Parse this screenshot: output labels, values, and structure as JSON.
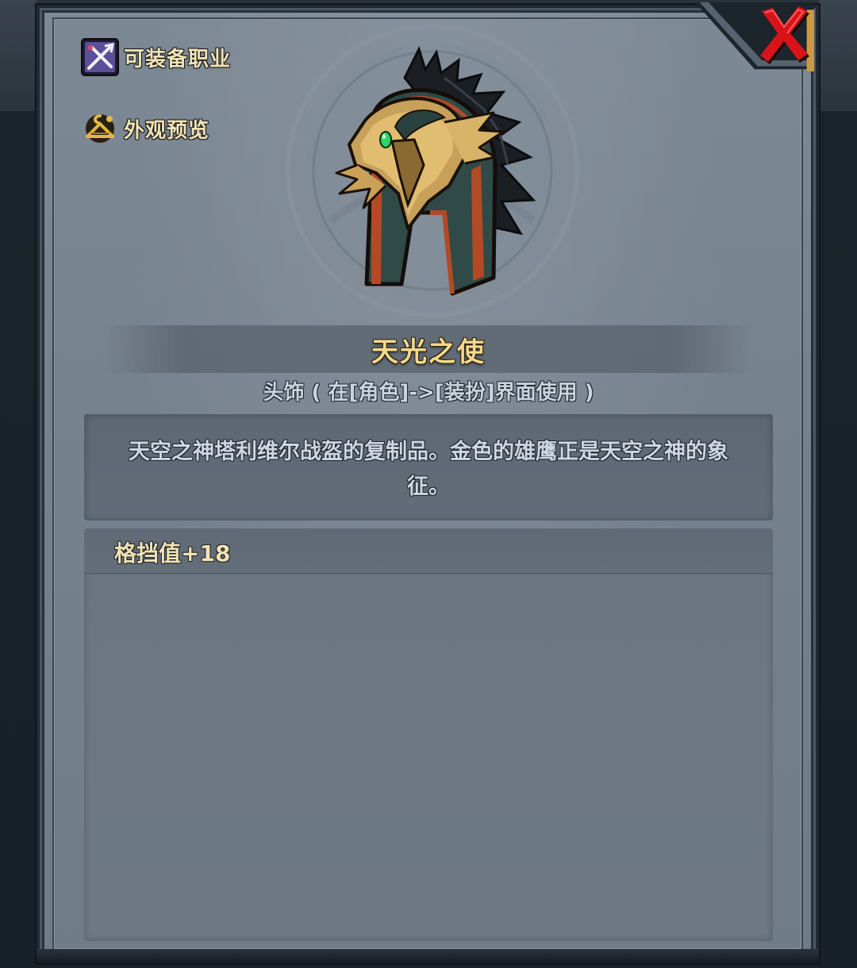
{
  "sidebar": {
    "equip_class_label": "可装备职业",
    "appearance_preview_label": "外观预览"
  },
  "item": {
    "name": "天光之使",
    "type_line": "头饰 ( 在[角色]->[装扮]界面使用 )",
    "description": "天空之神塔利维尔战盔的复制品。金色的雄鹰正是天空之神的象征。",
    "stats": [
      "格挡值+18"
    ]
  },
  "icons": {
    "close": "close-x-icon",
    "equip_class": "crossed-weapons-icon",
    "appearance": "hanger-icon",
    "item": "eagle-helmet-icon"
  },
  "colors": {
    "title_gold": "#f3d98a",
    "label_cream": "#f0e3b6",
    "close_red": "#d8141a",
    "panel_gray": "#7a8692"
  }
}
